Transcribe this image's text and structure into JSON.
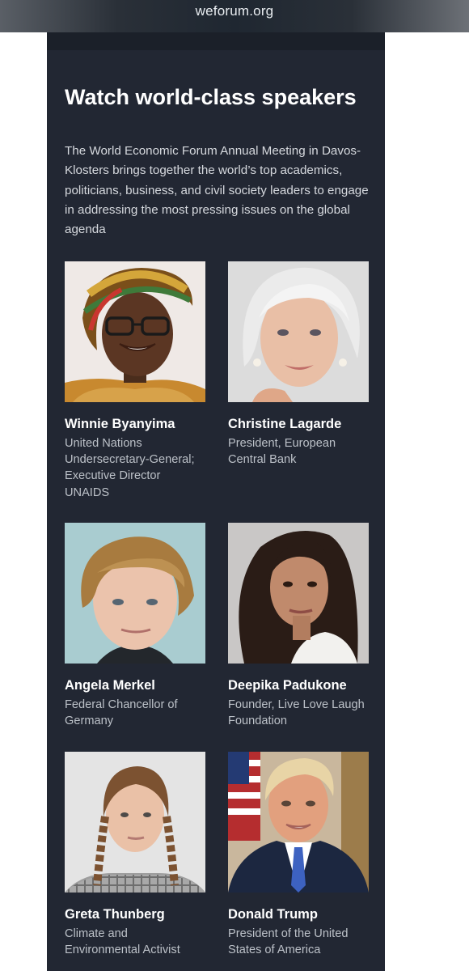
{
  "browser": {
    "url": "weforum.org"
  },
  "section": {
    "title": "Watch world-class speakers",
    "description": "The World Economic Forum Annual Meeting in Davos-Klosters brings together the world’s top academics, politicians, business, and civil society leaders to engage in addressing the most pressing issues on the global agenda"
  },
  "speakers": [
    {
      "name": "Winnie Byanyima",
      "role": "United Nations Undersecretary-General; Executive Director UNAIDS"
    },
    {
      "name": "Christine Lagarde",
      "role": "President, European Central Bank"
    },
    {
      "name": "Angela Merkel",
      "role": "Federal Chancellor of Germany"
    },
    {
      "name": "Deepika Padukone",
      "role": "Founder, Live Love Laugh Foundation"
    },
    {
      "name": "Greta Thunberg",
      "role": "Climate and Environmental Activist"
    },
    {
      "name": "Donald Trump",
      "role": "President of the United States of America"
    }
  ],
  "colors": {
    "panel_background": "#222733",
    "heading_text": "#ffffff",
    "body_text": "#d6d9de"
  }
}
